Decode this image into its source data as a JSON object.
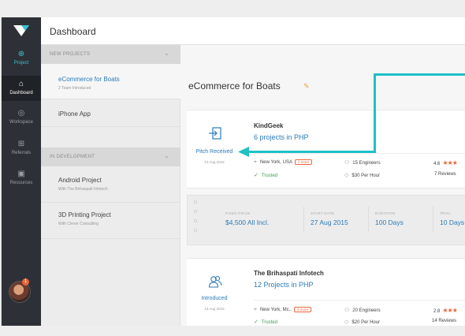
{
  "topbar": {
    "title": "Dashboard"
  },
  "rail": {
    "items": [
      {
        "label": "Project",
        "icon": "plus-circle-icon"
      },
      {
        "label": "Dashboard",
        "icon": "home-icon"
      },
      {
        "label": "Workspace",
        "icon": "target-icon"
      },
      {
        "label": "Referrals",
        "icon": "gift-icon"
      },
      {
        "label": "Resources",
        "icon": "briefcase-icon"
      }
    ],
    "avatar_badge": "1"
  },
  "projects_panel": {
    "new_section": "NEW PROJECTS",
    "new_items": [
      {
        "name": "eCommerce for Boats",
        "sub": "2 Team Introduced"
      },
      {
        "name": "iPhone App",
        "sub": ""
      }
    ],
    "dev_section": "IN DEVELOPMENT",
    "dev_items": [
      {
        "name": "Android Project",
        "sub": "With The Brihaspati Infotech"
      },
      {
        "name": "3D Printing Project",
        "sub": "With Clever Consulting"
      }
    ]
  },
  "main": {
    "title": "eCommerce for Boats",
    "cards": [
      {
        "status": "Pitch Received",
        "date": "13 Aug 2015",
        "company": "KindGeek",
        "projects": "6 projects",
        "in_tech": "in PHP",
        "location": "New York, USA",
        "more": "1 more",
        "engineers": "15 Engineers",
        "trusted": "Trusted",
        "rate": "$30 Per Hour",
        "rating": "4.6",
        "stars": "★★★",
        "reviews": "7 Reviews"
      },
      {
        "status": "Introduced",
        "date": "13 Aug 2015",
        "company": "The Brihaspati Infotech",
        "projects": "12 Projects",
        "in_tech": "in PHP",
        "location": "New York, Mc..",
        "more": "3 more",
        "engineers": "20 Engineers",
        "trusted": "Trusted",
        "rate": "$20 Per Hour",
        "rating": "2.8",
        "stars": "★★★",
        "reviews": "14 Reviews"
      }
    ],
    "details": [
      {
        "label": "FIXED PRICE",
        "value": "$4,500 All Incl."
      },
      {
        "label": "START DATE",
        "value": "27 Aug 2015"
      },
      {
        "label": "DURATION",
        "value": "100 Days"
      },
      {
        "label": "TRIAL",
        "value": "10 Days"
      }
    ]
  },
  "colors": {
    "accent": "#2b7bb9",
    "highlight": "#1fc0c8",
    "warning": "#e8673c",
    "success": "#3a9d4c",
    "rail": "#2d3036"
  }
}
